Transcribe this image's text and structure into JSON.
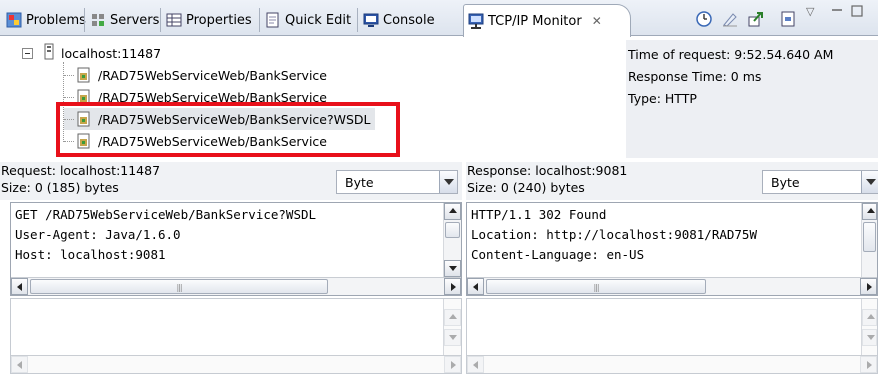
{
  "tabs": [
    {
      "label": "Problems",
      "icon": "problems-icon"
    },
    {
      "label": "Servers",
      "icon": "servers-icon"
    },
    {
      "label": "Properties",
      "icon": "properties-icon"
    },
    {
      "label": "Quick Edit",
      "icon": "quick-edit-icon"
    },
    {
      "label": "Console",
      "icon": "console-icon"
    },
    {
      "label": "TCP/IP Monitor",
      "icon": "tcpip-monitor-icon",
      "active": true
    }
  ],
  "tree": {
    "root": "localhost:11487",
    "items": [
      "/RAD75WebServiceWeb/BankService",
      "/RAD75WebServiceWeb/BankService",
      "/RAD75WebServiceWeb/BankService?WSDL",
      "/RAD75WebServiceWeb/BankService"
    ]
  },
  "meta": {
    "time": "Time of request: 9:52.54.640 AM",
    "response_time": "Response Time: 0 ms",
    "type": "Type: HTTP"
  },
  "request": {
    "host": "Request: localhost:11487",
    "size": "Size: 0 (185) bytes",
    "format": "Byte",
    "lines": [
      "GET /RAD75WebServiceWeb/BankService?WSDL",
      "User-Agent: Java/1.6.0",
      "Host: localhost:9081"
    ]
  },
  "response": {
    "host": "Response: localhost:9081",
    "size": "Size: 0 (240) bytes",
    "format": "Byte",
    "lines": [
      "HTTP/1.1 302 Found",
      "Location: http://localhost:9081/RAD75W",
      "Content-Language: en-US"
    ]
  },
  "colors": {
    "highlight": "#e8101a",
    "selection": "#e3e6ea"
  }
}
